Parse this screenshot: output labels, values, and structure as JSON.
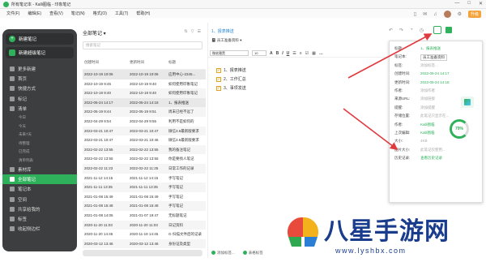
{
  "window": {
    "title": "所有笔记本 - Kalli图临 - 印象笔记",
    "controls": [
      "—",
      "□",
      "✕"
    ]
  },
  "menu": [
    "文件(F)",
    "编辑(E)",
    "查看(V)",
    "笔记(N)",
    "格式(O)",
    "工具(T)",
    "帮助(H)"
  ],
  "topbar": {
    "upgrade_label": "升级"
  },
  "sidebar": {
    "new_note": "新建笔记",
    "new_super_note": "新建超级笔记",
    "items": [
      {
        "label": "更多新建",
        "type": "main"
      },
      {
        "label": "首页",
        "type": "main"
      },
      {
        "label": "快捷方式",
        "type": "main"
      },
      {
        "label": "标记",
        "type": "main"
      },
      {
        "label": "清单",
        "type": "main"
      },
      {
        "label": "今日",
        "type": "sub"
      },
      {
        "label": "今天",
        "type": "sub"
      },
      {
        "label": "未来7天",
        "type": "sub"
      },
      {
        "label": "待整理",
        "type": "sub"
      },
      {
        "label": "已完成",
        "type": "sub"
      },
      {
        "label": "清单列表",
        "type": "sub"
      },
      {
        "label": "素材库",
        "type": "main"
      },
      {
        "label": "全部笔记",
        "type": "main",
        "active": true
      },
      {
        "label": "笔记本",
        "type": "main"
      },
      {
        "label": "空间",
        "type": "main"
      },
      {
        "label": "共享给我的",
        "type": "main"
      },
      {
        "label": "标签",
        "type": "main"
      },
      {
        "label": "收起侧边栏",
        "type": "main"
      }
    ]
  },
  "notelist": {
    "title": "全部笔记",
    "search_placeholder": "搜索笔记",
    "columns": [
      "创建时间",
      "更新时间",
      "标题"
    ],
    "rows": [
      [
        "2022-10-19 10:06",
        "2022-10-19 10:06",
        "应用中心-2345...",
        "sel"
      ],
      [
        "2022-10-19 9:45",
        "2022-10-19 9:40",
        "如何使用印象笔记",
        ""
      ],
      [
        "2022-10-19 9:40",
        "2022-10-19 9:40",
        "如何使用印象笔记",
        "alt"
      ],
      [
        "2022-05-24 14:17",
        "2022-05-24 14:18",
        "1、报表推送",
        "sel"
      ],
      [
        "2022-05-19 9:44",
        "2022-05-19 9:51",
        "周末已经不远了",
        "alt"
      ],
      [
        "2022-04-29 9:54",
        "2022-04-29 9:55",
        "利用不是如何的",
        ""
      ],
      [
        "2022-03-21 10:47",
        "2022-03-21 10:47",
        "微信3.6最新版要求",
        "alt"
      ],
      [
        "2022-03-21 10:47",
        "2022-03-21 10:46",
        "微信3.6最新版要求",
        ""
      ],
      [
        "2022-02-22 13:55",
        "2022-02-22 13:55",
        "我的备注笔记",
        "alt"
      ],
      [
        "2022-02-22 13:55",
        "2022-02-22 13:55",
        "你是要找人笔记",
        ""
      ],
      [
        "2022-02-22 11:23",
        "2022-02-22 11:25",
        "日常工作的记录",
        "alt"
      ],
      [
        "2021-11-12 14:15",
        "2021-11-12 14:15",
        "手写笔记",
        ""
      ],
      [
        "2021-11-11 13:35",
        "2021-11-11 13:35",
        "手写笔记",
        "alt"
      ],
      [
        "2021-01-08 15:49",
        "2021-01-08 15:49",
        "手写笔记",
        ""
      ],
      [
        "2021-01-08 15:48",
        "2021-01-08 15:48",
        "手写笔记",
        "alt"
      ],
      [
        "2021-01-08 14:05",
        "2021-01-07 19:47",
        "无标题笔记",
        ""
      ],
      [
        "2020-11-20 11:03",
        "2020-11-20 11:03",
        "日记资料",
        "alt"
      ],
      [
        "2020-11-20 14:46",
        "2020-11-19 14:45",
        "G·扫描文件后的记录",
        ""
      ],
      [
        "2020-03-12 13:46",
        "2020-03-12 13:46",
        "身份证及类型",
        "alt"
      ]
    ]
  },
  "editor": {
    "title": "1、报表推送",
    "category": "员工准备资料",
    "font": "微软雅黑",
    "size": "10",
    "checklist": [
      "1、报表推送",
      "2、工作汇总",
      "3、事项发送"
    ],
    "footer_add_tag": "添加标签...",
    "footer_status": "表格标签"
  },
  "info_panel": {
    "rows": [
      {
        "k": "标题:",
        "v": "1、报表推送",
        "style": "green"
      },
      {
        "k": "笔记本:",
        "v": "员工准备资料",
        "style": "select"
      },
      {
        "k": "标签:",
        "v": "添加标签...",
        "style": "gray"
      },
      {
        "k": "创建时间:",
        "v": "2022-05-24 14:17",
        "style": "green"
      },
      {
        "k": "更新时间:",
        "v": "2022-05-24 14:18",
        "style": "green"
      },
      {
        "k": "作者:",
        "v": "添加作者",
        "style": "gray"
      },
      {
        "k": "来源URL:",
        "v": "添加链接",
        "style": "gray"
      },
      {
        "k": "提醒:",
        "v": "添加提醒",
        "style": "gray"
      },
      {
        "k": "存储位置:",
        "v": "此笔记只显示在...",
        "style": "gray"
      },
      {
        "k": "作者:",
        "v": "Kalli图临",
        "style": "green"
      },
      {
        "k": "上次编辑:",
        "v": "Kalli图临",
        "style": "green"
      },
      {
        "k": "大小:",
        "v": "4KB",
        "style": "gray"
      },
      {
        "k": "图片大小:",
        "v": "此笔记仅使用...",
        "style": "gray"
      },
      {
        "k": "历史记录:",
        "v": "查看历史记录",
        "style": "green"
      }
    ],
    "usage_percent": "79%"
  },
  "watermark": {
    "text": "八星手游网",
    "url": "www.lyshbx.com"
  },
  "colors": {
    "accent": "#2fb15c",
    "sidebar_bg": "#3d3e3f",
    "arrow": "#e0393e",
    "upgrade": "#f3a33b"
  }
}
